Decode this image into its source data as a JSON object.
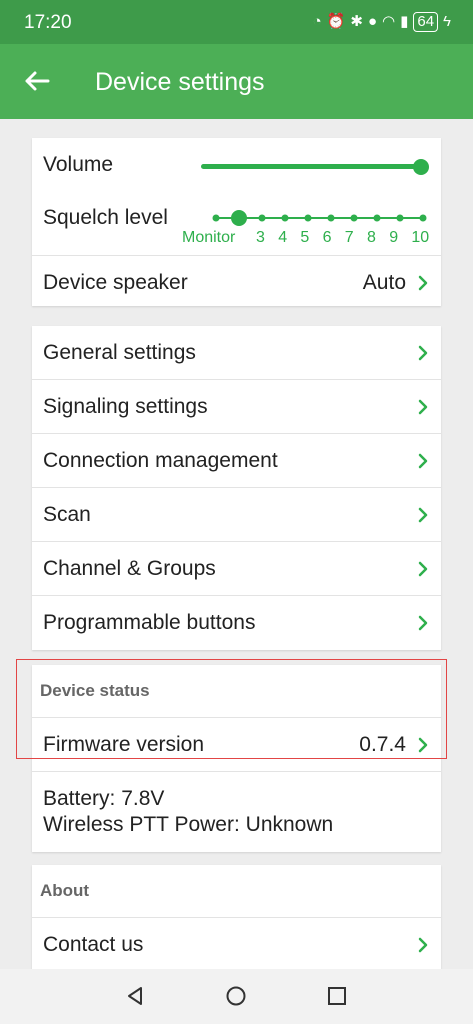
{
  "status_bar": {
    "time": "17:20",
    "battery": "64"
  },
  "app_bar": {
    "title": "Device settings"
  },
  "audio": {
    "volume_label": "Volume",
    "volume_level": 1.0,
    "squelch_label": "Squelch level",
    "squelch_ticks": [
      "Monitor",
      "3",
      "4",
      "5",
      "6",
      "7",
      "8",
      "9",
      "10"
    ],
    "squelch_selected_index": 1,
    "speaker_label": "Device speaker",
    "speaker_value": "Auto"
  },
  "menu": {
    "items": [
      {
        "label": "General settings"
      },
      {
        "label": "Signaling settings"
      },
      {
        "label": "Connection management"
      },
      {
        "label": "Scan"
      },
      {
        "label": "Channel & Groups"
      },
      {
        "label": "Programmable buttons"
      }
    ]
  },
  "device_status": {
    "header": "Device status",
    "firmware_label": "Firmware version",
    "firmware_value": "0.7.4",
    "battery_line": "Battery: 7.8V",
    "ptt_power_line": "Wireless PTT Power: Unknown"
  },
  "about": {
    "header": "About",
    "contact_label": "Contact us"
  },
  "colors": {
    "accent": "#2eaf4c",
    "appbar": "#4caf56",
    "statusbar": "#3e9b4a",
    "highlight": "#e24545"
  }
}
